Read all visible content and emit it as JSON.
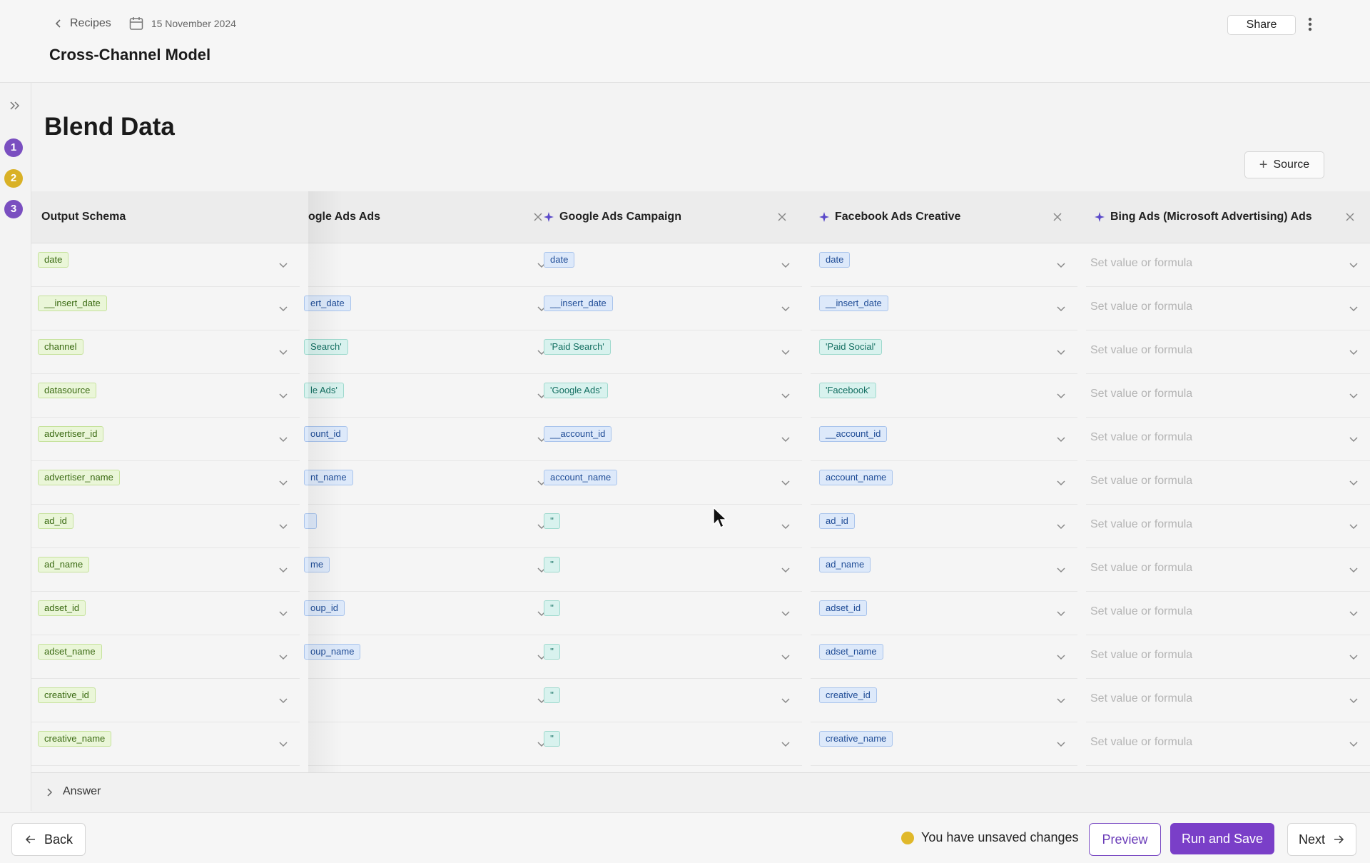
{
  "header": {
    "breadcrumb_label": "Recipes",
    "date": "15 November 2024",
    "title": "Cross-Channel Model",
    "share_label": "Share"
  },
  "steps": [
    {
      "number": "1",
      "color": "#7a4fc0"
    },
    {
      "number": "2",
      "color": "#d9b126"
    },
    {
      "number": "3",
      "color": "#7a4fc0"
    }
  ],
  "main": {
    "title": "Blend Data",
    "add_source_label": "Source"
  },
  "columns": [
    {
      "title": "Output Schema",
      "ai": false,
      "closable": false,
      "kind": "output"
    },
    {
      "title": "ogle Ads Ads",
      "ai": false,
      "closable": true,
      "kind": "source"
    },
    {
      "title": "Google Ads Campaign",
      "ai": true,
      "closable": true,
      "kind": "source"
    },
    {
      "title": "Facebook Ads Creative",
      "ai": true,
      "closable": true,
      "kind": "source"
    },
    {
      "title": "Bing Ads (Microsoft Advertising) Ads",
      "ai": true,
      "closable": true,
      "kind": "source"
    }
  ],
  "placeholder": "Set value or formula",
  "rows": [
    {
      "schema": "date",
      "c1": {
        "text": "",
        "style": ""
      },
      "c2": {
        "text": "date",
        "style": "b"
      },
      "c3": {
        "text": "date",
        "style": "b"
      }
    },
    {
      "schema": "__insert_date",
      "c1": {
        "text": "ert_date",
        "style": "b"
      },
      "c2": {
        "text": "__insert_date",
        "style": "b"
      },
      "c3": {
        "text": "__insert_date",
        "style": "b"
      }
    },
    {
      "schema": "channel",
      "c1": {
        "text": "Search'",
        "style": "t"
      },
      "c2": {
        "text": "'Paid Search'",
        "style": "t"
      },
      "c3": {
        "text": "'Paid Social'",
        "style": "t"
      }
    },
    {
      "schema": "datasource",
      "c1": {
        "text": "le Ads'",
        "style": "t"
      },
      "c2": {
        "text": "'Google Ads'",
        "style": "t"
      },
      "c3": {
        "text": "'Facebook'",
        "style": "t"
      }
    },
    {
      "schema": "advertiser_id",
      "c1": {
        "text": "ount_id",
        "style": "b"
      },
      "c2": {
        "text": "__account_id",
        "style": "b"
      },
      "c3": {
        "text": "__account_id",
        "style": "b"
      }
    },
    {
      "schema": "advertiser_name",
      "c1": {
        "text": "nt_name",
        "style": "b"
      },
      "c2": {
        "text": "account_name",
        "style": "b"
      },
      "c3": {
        "text": "account_name",
        "style": "b"
      }
    },
    {
      "schema": "ad_id",
      "c1": {
        "text": " ",
        "style": "b"
      },
      "c2": {
        "text": "''",
        "style": "t"
      },
      "c3": {
        "text": "ad_id",
        "style": "b"
      }
    },
    {
      "schema": "ad_name",
      "c1": {
        "text": "me",
        "style": "b"
      },
      "c2": {
        "text": "''",
        "style": "t"
      },
      "c3": {
        "text": "ad_name",
        "style": "b"
      }
    },
    {
      "schema": "adset_id",
      "c1": {
        "text": "oup_id",
        "style": "b"
      },
      "c2": {
        "text": "''",
        "style": "t"
      },
      "c3": {
        "text": "adset_id",
        "style": "b"
      }
    },
    {
      "schema": "adset_name",
      "c1": {
        "text": "oup_name",
        "style": "b"
      },
      "c2": {
        "text": "''",
        "style": "t"
      },
      "c3": {
        "text": "adset_name",
        "style": "b"
      }
    },
    {
      "schema": "creative_id",
      "c1": {
        "text": "",
        "style": ""
      },
      "c2": {
        "text": "''",
        "style": "t"
      },
      "c3": {
        "text": "creative_id",
        "style": "b"
      }
    },
    {
      "schema": "creative_name",
      "c1": {
        "text": "",
        "style": ""
      },
      "c2": {
        "text": "''",
        "style": "t"
      },
      "c3": {
        "text": "creative_name",
        "style": "b"
      }
    }
  ],
  "answer_label": "Answer",
  "footer": {
    "back_label": "Back",
    "unsaved_text": "You have unsaved changes",
    "preview_label": "Preview",
    "run_save_label": "Run and Save",
    "next_label": "Next"
  },
  "colors": {
    "accent": "#7a3fc8",
    "warning_dot": "#e0b82a"
  }
}
